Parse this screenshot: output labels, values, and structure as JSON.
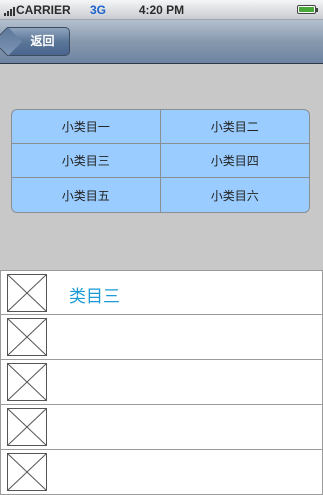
{
  "status_bar": {
    "carrier": "CARRIER",
    "network": "3G",
    "time": "4:20 PM",
    "battery_level": 1.0
  },
  "nav_bar": {
    "back_label": "返回"
  },
  "category_grid": {
    "items": [
      "小类目一",
      "小类目二",
      "小类目三",
      "小类目四",
      "小类目五",
      "小类目六"
    ],
    "background_color": "#9accff"
  },
  "list": {
    "rows": [
      {
        "title": "类目三"
      },
      {
        "title": ""
      },
      {
        "title": ""
      },
      {
        "title": ""
      },
      {
        "title": ""
      }
    ],
    "title_color": "#1a9ad6"
  }
}
